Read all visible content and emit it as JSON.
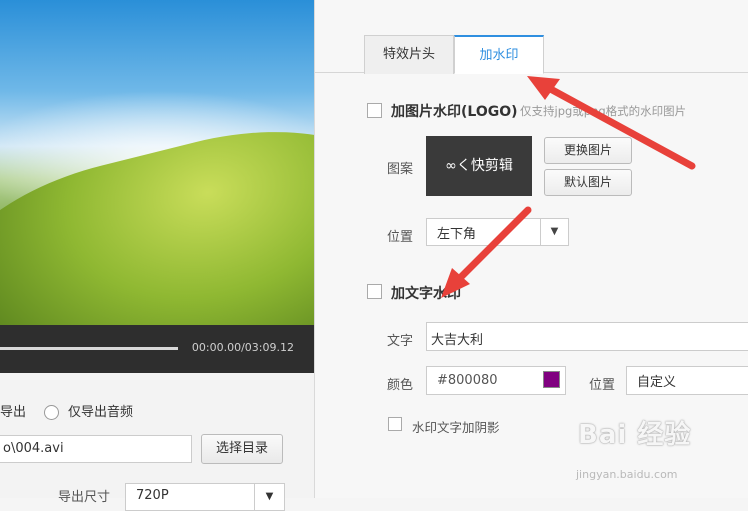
{
  "player": {
    "time": "00:00.00/03:09.12",
    "progress_fraction": 0.94
  },
  "export": {
    "option_suffix": "导出",
    "audio_only": "仅导出音频",
    "path": "o\\004.avi",
    "choose_dir": "选择目录",
    "size_label": "导出尺寸",
    "size_value": "720P"
  },
  "tabs": [
    "特效片头",
    "加水印"
  ],
  "logo_watermark": {
    "title": "加图片水印(LOGO)",
    "note": "仅支持jpg或png格式的水印图片",
    "pattern_label": "图案",
    "logo_text": "∞く快剪辑",
    "change_button": "更换图片",
    "default_button": "默认图片",
    "position_label": "位置",
    "position_value": "左下角"
  },
  "text_watermark": {
    "title": "加文字水印",
    "text_label": "文字",
    "text_value": "大吉大利",
    "color_label": "颜色",
    "color_value": "#800080",
    "swatch_color": "#800080",
    "position_label": "位置",
    "position_value": "自定义",
    "shadow_label": "水印文字加阴影"
  },
  "watermark": {
    "brand": "Bai 经验",
    "site": "jingyan.baidu.com"
  },
  "colors": {
    "accent": "#2f8fe0",
    "arrow": "#e8413a"
  }
}
